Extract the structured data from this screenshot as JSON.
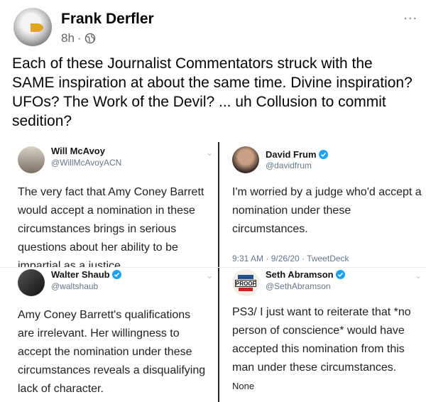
{
  "post": {
    "author": "Frank Derfler",
    "time": "8h",
    "separator": "·",
    "more": "...",
    "text": "Each of these Journalist Commentators struck with the SAME inspiration at about the same time.  Divine inspiration?  UFOs? The Work of the Devil?    ... uh Collusion to commit sedition?"
  },
  "tweets": {
    "t1": {
      "name": "Will McAvoy",
      "handle": "@WillMcAvoyACN",
      "body": "The very fact that Amy Coney Barrett would accept a nomination in these circumstances brings in serious questions about her ability to be impartial as a justice."
    },
    "t2": {
      "name": "David Frum",
      "handle": "@davidfrum",
      "body": "I'm worried by a judge who'd accept a nomination under these circumstances.",
      "meta": "9:31 AM · 9/26/20 · TweetDeck"
    },
    "t3": {
      "name": "Walter Shaub",
      "handle": "@waltshaub",
      "body": "Amy Coney Barrett's qualifications are irrelevant. Her willingness to accept the nomination under these circumstances reveals a disqualifying lack of character."
    },
    "t4": {
      "name": "Seth Abramson",
      "handle": "@SethAbramson",
      "badge": "PROOF",
      "body": "PS3/ I just want to reiterate that *no person of conscience* would have accepted this nomination from this man under these circumstances.",
      "tail": "None"
    }
  },
  "colors": {
    "verified": "#1da1f2",
    "meta_gray": "#65676b"
  }
}
